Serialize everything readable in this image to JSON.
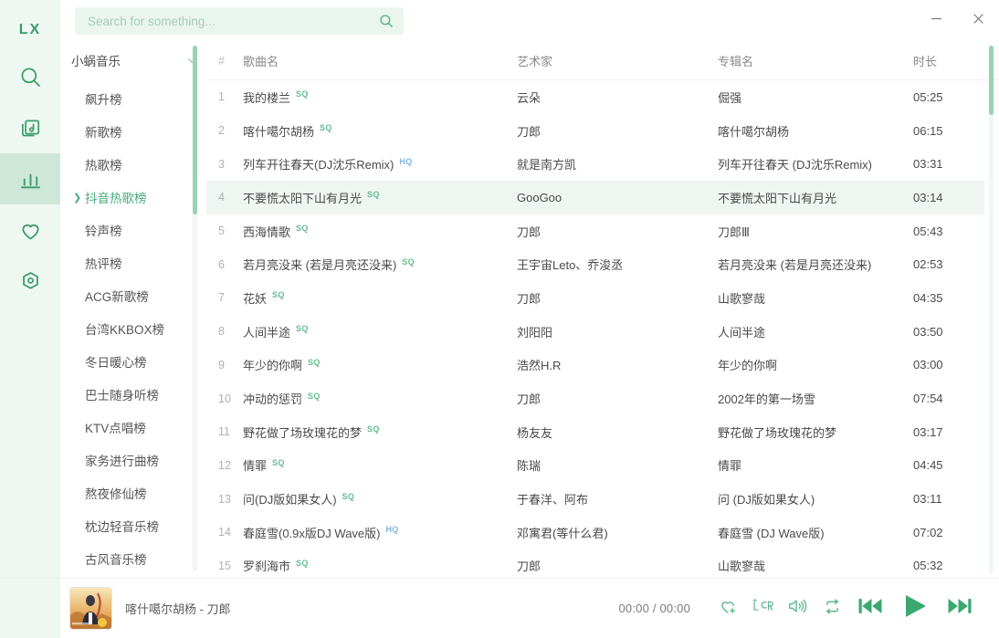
{
  "app": {
    "logo": "LX",
    "window_controls": {
      "minimize": "minimize-icon",
      "close": "close-icon"
    }
  },
  "rail": {
    "items": [
      {
        "name": "search",
        "icon": "search-icon",
        "active": false
      },
      {
        "name": "my-music",
        "icon": "music-library-icon",
        "active": false
      },
      {
        "name": "leaderboard",
        "icon": "chart-bars-icon",
        "active": true
      },
      {
        "name": "favorites",
        "icon": "heart-icon",
        "active": false
      },
      {
        "name": "settings",
        "icon": "gear-hexagon-icon",
        "active": false
      }
    ]
  },
  "search": {
    "placeholder": "Search for something...",
    "value": "",
    "icon": "search-icon"
  },
  "sidebar": {
    "source": {
      "label": "小蜗音乐",
      "chevron": "chevron-down-icon"
    },
    "items": [
      {
        "label": "飙升榜",
        "active": false
      },
      {
        "label": "新歌榜",
        "active": false
      },
      {
        "label": "热歌榜",
        "active": false
      },
      {
        "label": "抖音热歌榜",
        "active": true
      },
      {
        "label": "铃声榜",
        "active": false
      },
      {
        "label": "热评榜",
        "active": false
      },
      {
        "label": "ACG新歌榜",
        "active": false
      },
      {
        "label": "台湾KKBOX榜",
        "active": false
      },
      {
        "label": "冬日暖心榜",
        "active": false
      },
      {
        "label": "巴士随身听榜",
        "active": false
      },
      {
        "label": "KTV点唱榜",
        "active": false
      },
      {
        "label": "家务进行曲榜",
        "active": false
      },
      {
        "label": "熬夜修仙榜",
        "active": false
      },
      {
        "label": "枕边轻音乐榜",
        "active": false
      },
      {
        "label": "古风音乐榜",
        "active": false
      }
    ]
  },
  "table": {
    "columns": {
      "num": "#",
      "title": "歌曲名",
      "artist": "艺术家",
      "album": "专辑名",
      "duration": "时长"
    },
    "rows": [
      {
        "num": "1",
        "title": "我的楼兰",
        "quality": "SQ",
        "artist": "云朵",
        "album": "倔强",
        "duration": "05:25",
        "selected": false
      },
      {
        "num": "2",
        "title": "喀什噶尔胡杨",
        "quality": "SQ",
        "artist": "刀郎",
        "album": "喀什噶尔胡杨",
        "duration": "06:15",
        "selected": false
      },
      {
        "num": "3",
        "title": "列车开往春天(DJ沈乐Remix)",
        "quality": "HQ",
        "artist": "就是南方凯",
        "album": "列车开往春天 (DJ沈乐Remix)",
        "duration": "03:31",
        "selected": false
      },
      {
        "num": "4",
        "title": "不要慌太阳下山有月光",
        "quality": "SQ",
        "artist": "GooGoo",
        "album": "不要慌太阳下山有月光",
        "duration": "03:14",
        "selected": true
      },
      {
        "num": "5",
        "title": "西海情歌",
        "quality": "SQ",
        "artist": "刀郎",
        "album": "刀郎Ⅲ",
        "duration": "05:43",
        "selected": false
      },
      {
        "num": "6",
        "title": "若月亮没来 (若是月亮还没来)",
        "quality": "SQ",
        "artist": "王宇宙Leto、乔浚丞",
        "album": "若月亮没来 (若是月亮还没来)",
        "duration": "02:53",
        "selected": false
      },
      {
        "num": "7",
        "title": "花妖",
        "quality": "SQ",
        "artist": "刀郎",
        "album": "山歌寥哉",
        "duration": "04:35",
        "selected": false
      },
      {
        "num": "8",
        "title": "人间半途",
        "quality": "SQ",
        "artist": "刘阳阳",
        "album": "人间半途",
        "duration": "03:50",
        "selected": false
      },
      {
        "num": "9",
        "title": "年少的你啊",
        "quality": "SQ",
        "artist": "浩然H.R",
        "album": "年少的你啊",
        "duration": "03:00",
        "selected": false
      },
      {
        "num": "10",
        "title": "冲动的惩罚",
        "quality": "SQ",
        "artist": "刀郎",
        "album": "2002年的第一场雪",
        "duration": "07:54",
        "selected": false
      },
      {
        "num": "11",
        "title": "野花做了场玫瑰花的梦",
        "quality": "SQ",
        "artist": "杨友友",
        "album": "野花做了场玫瑰花的梦",
        "duration": "03:17",
        "selected": false
      },
      {
        "num": "12",
        "title": "情罪",
        "quality": "SQ",
        "artist": "陈瑞",
        "album": "情罪",
        "duration": "04:45",
        "selected": false
      },
      {
        "num": "13",
        "title": "问(DJ版如果女人)",
        "quality": "SQ",
        "artist": "于春洋、阿布",
        "album": "问 (DJ版如果女人)",
        "duration": "03:11",
        "selected": false
      },
      {
        "num": "14",
        "title": "春庭雪(0.9x版DJ Wave版)",
        "quality": "HQ",
        "artist": "邓寓君(等什么君)",
        "album": "春庭雪 (DJ Wave版)",
        "duration": "07:02",
        "selected": false
      },
      {
        "num": "15",
        "title": "罗刹海市",
        "quality": "SQ",
        "artist": "刀郎",
        "album": "山歌寥哉",
        "duration": "05:32",
        "selected": false
      }
    ]
  },
  "player": {
    "now_playing": "喀什噶尔胡杨 - 刀郎",
    "time": "00:00 / 00:00",
    "buttons": [
      {
        "name": "favorite",
        "icon": "heart-plus-icon"
      },
      {
        "name": "lyrics",
        "icon": "lrc-icon"
      },
      {
        "name": "volume",
        "icon": "volume-icon"
      },
      {
        "name": "repeat",
        "icon": "repeat-icon"
      },
      {
        "name": "previous",
        "icon": "skip-back-icon"
      },
      {
        "name": "play",
        "icon": "play-icon"
      },
      {
        "name": "next",
        "icon": "skip-forward-icon"
      }
    ]
  },
  "colors": {
    "accent": "#49ab78",
    "rail_bg": "#eef7f1",
    "selected_row": "#eff5f1",
    "sq_badge": "#63bd90",
    "hq_badge": "#7fb6e0"
  }
}
